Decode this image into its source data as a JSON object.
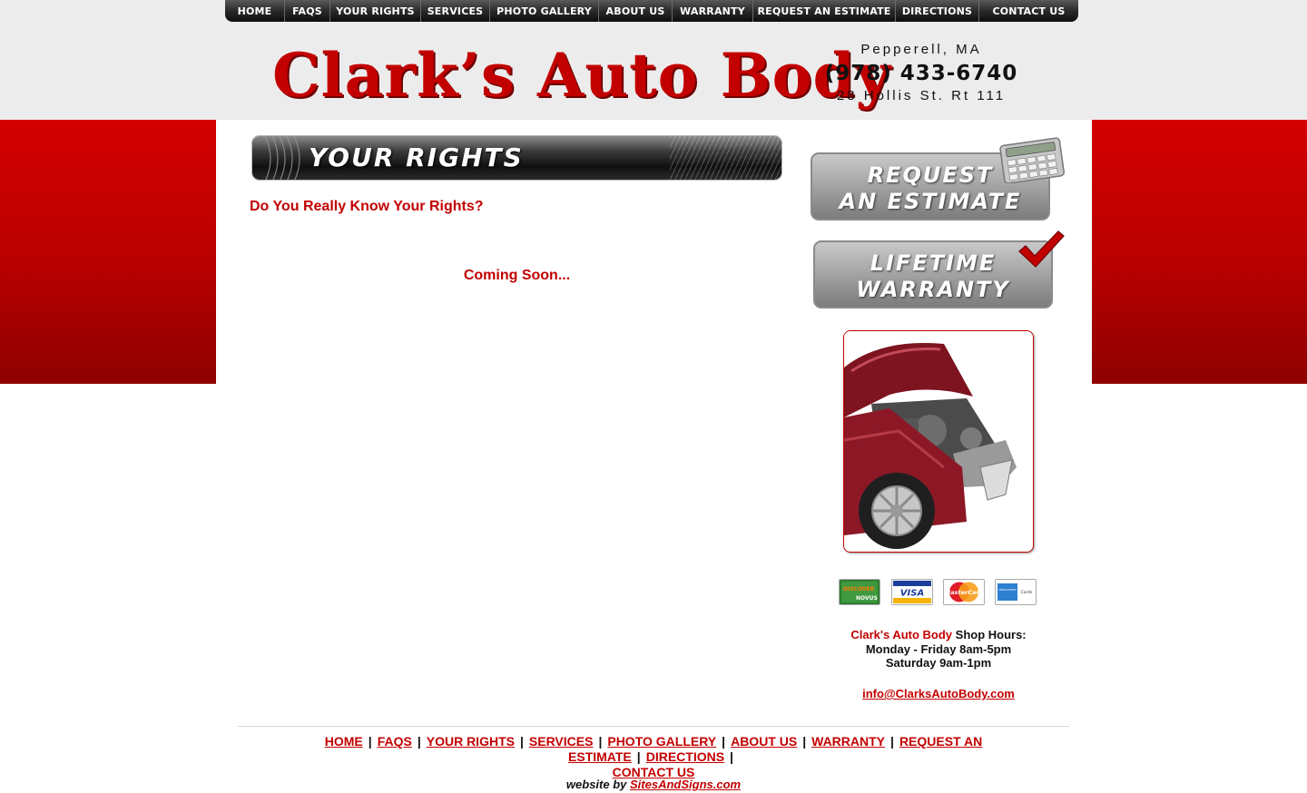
{
  "nav": {
    "items": [
      "HOME",
      "FAQS",
      "YOUR RIGHTS",
      "SERVICES",
      "PHOTO GALLERY",
      "ABOUT US",
      "WARRANTY",
      "REQUEST AN ESTIMATE",
      "DIRECTIONS",
      "CONTACT US"
    ]
  },
  "header": {
    "logo_text": "Clark’s Auto Body",
    "city": "Pepperell, MA",
    "phone": "(978) 433-6740",
    "street": "28 Hollis St. Rt 111"
  },
  "page": {
    "title": "YOUR RIGHTS",
    "heading": "Do You Really Know Your Rights?",
    "body": "Coming Soon..."
  },
  "sidebar": {
    "estimate_line1": "REQUEST",
    "estimate_line2": "AN ESTIMATE",
    "warranty_line1": "LIFETIME",
    "warranty_line2": "WARRANTY",
    "cards": {
      "discover": "DISCOVER",
      "novus": "NOVUS",
      "visa": "VISA",
      "mastercard": "MasterCard",
      "amex": "AMERICAN EXPRESS",
      "amex_cards": "Cards"
    },
    "hours_brand": "Clark's Auto Body",
    "hours_label": " Shop Hours:",
    "hours_weekday": "Monday - Friday 8am-5pm",
    "hours_saturday": "Saturday 9am-1pm",
    "email": "info@ClarksAutoBody.com"
  },
  "footer": {
    "links": [
      "HOME",
      "FAQS",
      "YOUR RIGHTS",
      "SERVICES",
      "PHOTO GALLERY",
      "ABOUT US",
      "WARRANTY",
      "REQUEST AN ESTIMATE",
      "DIRECTIONS",
      "CONTACT US"
    ],
    "separator": "|",
    "credit_prefix": "website by ",
    "credit_link": "SitesAndSigns.com"
  },
  "colors": {
    "brand_red": "#c30000",
    "nav_black": "#1a1a1a",
    "header_gray": "#ececec"
  }
}
